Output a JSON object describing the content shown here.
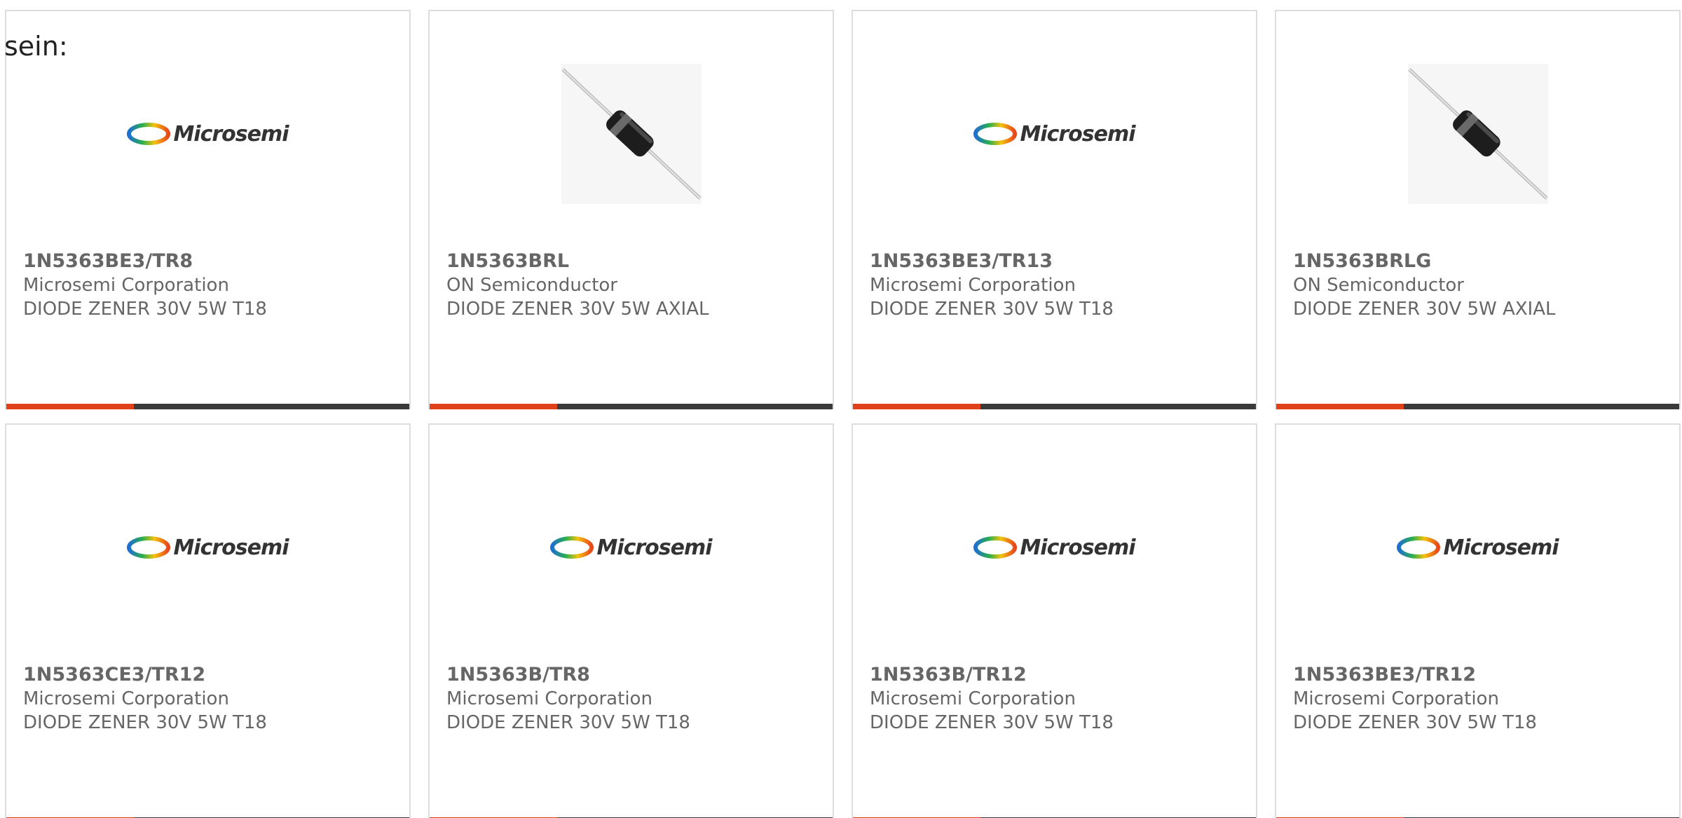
{
  "intro_text": "sein:",
  "accent_color": "#e0411a",
  "bar_color": "#3a3a3a",
  "products": [
    {
      "part_number": "1N5363BE3/TR8",
      "manufacturer": "Microsemi Corporation",
      "description": "DIODE ZENER 30V 5W T18",
      "image": "microsemi-logo",
      "logo_text": "Microsemi"
    },
    {
      "part_number": "1N5363BRL",
      "manufacturer": "ON Semiconductor",
      "description": "DIODE ZENER 30V 5W AXIAL",
      "image": "axial-diode-photo",
      "logo_text": ""
    },
    {
      "part_number": "1N5363BE3/TR13",
      "manufacturer": "Microsemi Corporation",
      "description": "DIODE ZENER 30V 5W T18",
      "image": "microsemi-logo",
      "logo_text": "Microsemi"
    },
    {
      "part_number": "1N5363BRLG",
      "manufacturer": "ON Semiconductor",
      "description": "DIODE ZENER 30V 5W AXIAL",
      "image": "axial-diode-photo",
      "logo_text": ""
    },
    {
      "part_number": "1N5363CE3/TR12",
      "manufacturer": "Microsemi Corporation",
      "description": "DIODE ZENER 30V 5W T18",
      "image": "microsemi-logo",
      "logo_text": "Microsemi"
    },
    {
      "part_number": "1N5363B/TR8",
      "manufacturer": "Microsemi Corporation",
      "description": "DIODE ZENER 30V 5W T18",
      "image": "microsemi-logo",
      "logo_text": "Microsemi"
    },
    {
      "part_number": "1N5363B/TR12",
      "manufacturer": "Microsemi Corporation",
      "description": "DIODE ZENER 30V 5W T18",
      "image": "microsemi-logo",
      "logo_text": "Microsemi"
    },
    {
      "part_number": "1N5363BE3/TR12",
      "manufacturer": "Microsemi Corporation",
      "description": "DIODE ZENER 30V 5W T18",
      "image": "microsemi-logo",
      "logo_text": "Microsemi"
    }
  ]
}
